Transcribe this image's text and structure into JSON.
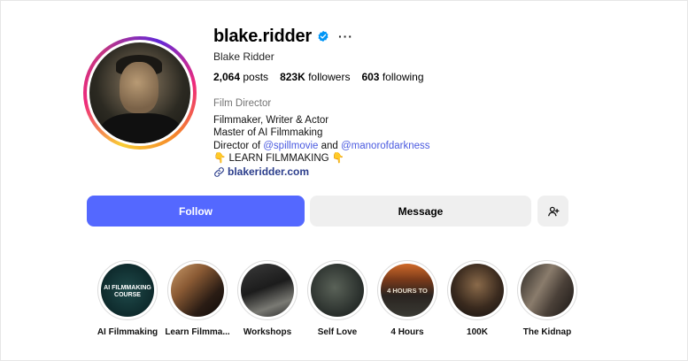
{
  "profile": {
    "username": "blake.ridder",
    "full_name": "Blake Ridder",
    "more_glyph": "···",
    "stats": {
      "posts_count": "2,064",
      "posts_label": "posts",
      "followers_count": "823K",
      "followers_label": "followers",
      "following_count": "603",
      "following_label": "following"
    },
    "category": "Film Director",
    "bio": {
      "line1": "Filmmaker, Writer & Actor",
      "line2": "Master of AI Filmmaking",
      "line3_prefix": "Director of ",
      "mention1": "@spillmovie",
      "line3_mid": " and ",
      "mention2": "@manorofdarkness",
      "line4_emoji_left": "👇",
      "line4_text": " LEARN FILMMAKING ",
      "line4_emoji_right": "👇"
    },
    "website": "blakeridder.com"
  },
  "actions": {
    "follow_label": "Follow",
    "message_label": "Message",
    "add_user_icon": "add-user-icon"
  },
  "highlights": [
    {
      "label": "AI Filmmaking",
      "caption": "AI FILMMAKING COURSE"
    },
    {
      "label": "Learn Filmma...",
      "caption": ""
    },
    {
      "label": "Workshops",
      "caption": ""
    },
    {
      "label": "Self Love",
      "caption": ""
    },
    {
      "label": "4 Hours",
      "caption": "4 HOURS TO"
    },
    {
      "label": "100K",
      "caption": ""
    },
    {
      "label": "The Kidnap",
      "caption": ""
    }
  ],
  "colors": {
    "follow_button": "#5468ff",
    "secondary_button": "#efefef",
    "verified_badge": "#0095f6",
    "mention_link": "#4a5ae0"
  }
}
